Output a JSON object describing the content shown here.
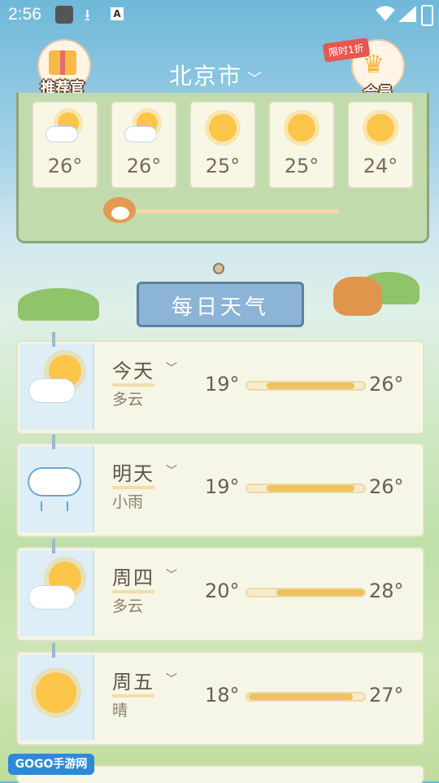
{
  "status_bar": {
    "time": "2:56",
    "a_label": "A"
  },
  "header": {
    "left_button_label": "推荐官",
    "city": "北京市",
    "vip_tag": "限时1折",
    "vip_label": "会员"
  },
  "hourly": [
    {
      "temp": "26°",
      "icon": "sun-cloud-icon"
    },
    {
      "temp": "26°",
      "icon": "sun-cloud-icon"
    },
    {
      "temp": "25°",
      "icon": "sun-icon"
    },
    {
      "temp": "25°",
      "icon": "sun-icon"
    },
    {
      "temp": "24°",
      "icon": "sun-icon"
    }
  ],
  "section_title": "每日天气",
  "daily": [
    {
      "day": "今天",
      "condition": "多云",
      "low": "19°",
      "high": "26°",
      "icon": "cloudy-icon"
    },
    {
      "day": "明天",
      "condition": "小雨",
      "low": "19°",
      "high": "26°",
      "icon": "light-rain-icon"
    },
    {
      "day": "周四",
      "condition": "多云",
      "low": "20°",
      "high": "28°",
      "icon": "cloudy-icon"
    },
    {
      "day": "周五",
      "condition": "晴",
      "low": "18°",
      "high": "27°",
      "icon": "sunny-icon"
    }
  ],
  "watermark": "GOGO手游网",
  "colors": {
    "bar_fill": "#f0c25e",
    "board_bg": "#c2dbac",
    "sign_bg": "#8bb4d6"
  }
}
